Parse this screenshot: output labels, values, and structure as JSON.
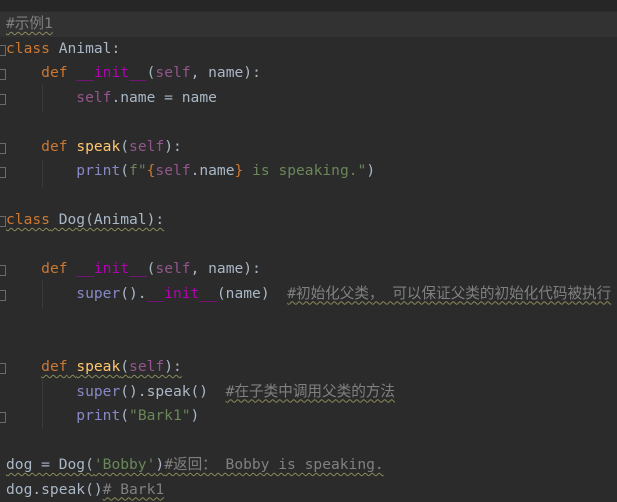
{
  "editor": {
    "lines": [
      {
        "tokens": [
          {
            "t": "#示例1",
            "c": "cm wavy"
          }
        ],
        "hl": true
      },
      {
        "tokens": [
          {
            "t": "class",
            "c": "kw"
          },
          {
            "t": " Animal:",
            "c": "tx"
          }
        ],
        "gutter": true
      },
      {
        "tokens": [
          {
            "t": "    "
          },
          {
            "t": "def",
            "c": "kw"
          },
          {
            "t": " "
          },
          {
            "t": "__init__",
            "c": "magic"
          },
          {
            "t": "(",
            "c": "tx"
          },
          {
            "t": "self",
            "c": "self"
          },
          {
            "t": ", name):",
            "c": "tx"
          }
        ],
        "gutter": true
      },
      {
        "tokens": [
          {
            "t": "        "
          },
          {
            "t": "self",
            "c": "self"
          },
          {
            "t": ".name = name",
            "c": "tx"
          }
        ],
        "gutter": true
      },
      {
        "tokens": []
      },
      {
        "tokens": [
          {
            "t": "    "
          },
          {
            "t": "def",
            "c": "kw"
          },
          {
            "t": " "
          },
          {
            "t": "speak",
            "c": "fn"
          },
          {
            "t": "(",
            "c": "tx"
          },
          {
            "t": "self",
            "c": "self"
          },
          {
            "t": "):",
            "c": "tx"
          }
        ],
        "gutter": true
      },
      {
        "tokens": [
          {
            "t": "        "
          },
          {
            "t": "print",
            "c": "bi"
          },
          {
            "t": "(",
            "c": "tx"
          },
          {
            "t": "f\"",
            "c": "str"
          },
          {
            "t": "{",
            "c": "kw"
          },
          {
            "t": "self",
            "c": "self"
          },
          {
            "t": ".name",
            "c": "tx"
          },
          {
            "t": "}",
            "c": "kw"
          },
          {
            "t": " is speaking.\"",
            "c": "str"
          },
          {
            "t": ")",
            "c": "tx"
          }
        ],
        "gutter": true
      },
      {
        "tokens": []
      },
      {
        "tokens": [
          {
            "t": "class",
            "c": "kw wavy"
          },
          {
            "t": " Dog(Animal):",
            "c": "tx wavy"
          }
        ],
        "gutter": true
      },
      {
        "tokens": []
      },
      {
        "tokens": [
          {
            "t": "    "
          },
          {
            "t": "def",
            "c": "kw"
          },
          {
            "t": " "
          },
          {
            "t": "__init__",
            "c": "magic"
          },
          {
            "t": "(",
            "c": "tx"
          },
          {
            "t": "self",
            "c": "self"
          },
          {
            "t": ", name):",
            "c": "tx"
          }
        ],
        "gutter": true
      },
      {
        "tokens": [
          {
            "t": "        "
          },
          {
            "t": "super",
            "c": "bi"
          },
          {
            "t": "().",
            "c": "tx"
          },
          {
            "t": "__init__",
            "c": "magic"
          },
          {
            "t": "(name)  ",
            "c": "tx"
          },
          {
            "t": "#初始化父类， 可以保证父类的初始化代码被执行",
            "c": "cm wavy"
          }
        ],
        "gutter": true
      },
      {
        "tokens": []
      },
      {
        "tokens": []
      },
      {
        "tokens": [
          {
            "t": "    "
          },
          {
            "t": "def",
            "c": "kw wavy"
          },
          {
            "t": " ",
            "c": "wavy"
          },
          {
            "t": "speak",
            "c": "fn wavy"
          },
          {
            "t": "(",
            "c": "tx wavy"
          },
          {
            "t": "self",
            "c": "self wavy"
          },
          {
            "t": "):",
            "c": "tx wavy"
          }
        ],
        "gutter": true
      },
      {
        "tokens": [
          {
            "t": "        "
          },
          {
            "t": "super",
            "c": "bi"
          },
          {
            "t": "().speak()  ",
            "c": "tx"
          },
          {
            "t": "#在子类中调用父类的方法",
            "c": "cm wavy"
          }
        ]
      },
      {
        "tokens": [
          {
            "t": "        "
          },
          {
            "t": "print",
            "c": "bi"
          },
          {
            "t": "(",
            "c": "tx"
          },
          {
            "t": "\"Bark1\"",
            "c": "str"
          },
          {
            "t": ")",
            "c": "tx"
          }
        ],
        "gutter": true
      },
      {
        "tokens": []
      },
      {
        "tokens": [
          {
            "t": "dog = Dog(",
            "c": "tx wavy"
          },
          {
            "t": "'Bobby'",
            "c": "str wavy"
          },
          {
            "t": ")",
            "c": "tx wavy"
          },
          {
            "t": "#返回： Bobby is speaking.",
            "c": "cm wavy"
          }
        ]
      },
      {
        "tokens": [
          {
            "t": "dog.speak()",
            "c": "tx"
          },
          {
            "t": "# Bark1",
            "c": "cm wavy"
          }
        ]
      }
    ]
  }
}
